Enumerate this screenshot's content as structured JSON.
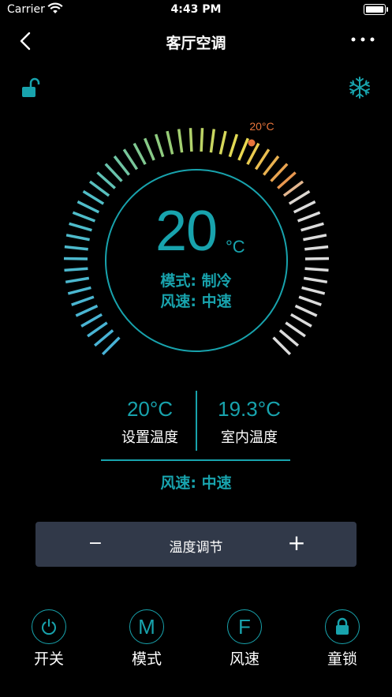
{
  "status": {
    "carrier": "Carrier",
    "time": "4:43 PM"
  },
  "navbar": {
    "title": "客厅空调"
  },
  "dial": {
    "set_temp": "20",
    "unit": "°C",
    "marker_label": "20°C",
    "mode": "模式: 制冷",
    "wind": "风速: 中速"
  },
  "readings": {
    "set_value": "20°C",
    "set_label": "设置温度",
    "indoor_value": "19.3°C",
    "indoor_label": "室内温度"
  },
  "wind_bottom": "风速: 中速",
  "adjust": {
    "minus": "−",
    "label": "温度调节",
    "plus": "+"
  },
  "bottom": {
    "power": {
      "glyph": "⏻",
      "label": "开关"
    },
    "mode": {
      "glyph": "M",
      "label": "模式"
    },
    "fan": {
      "glyph": "F",
      "label": "风速"
    },
    "lock": {
      "label": "童锁"
    }
  },
  "colors": {
    "accent": "#18a3ad",
    "marker": "#e8743b",
    "panel": "#313949"
  }
}
